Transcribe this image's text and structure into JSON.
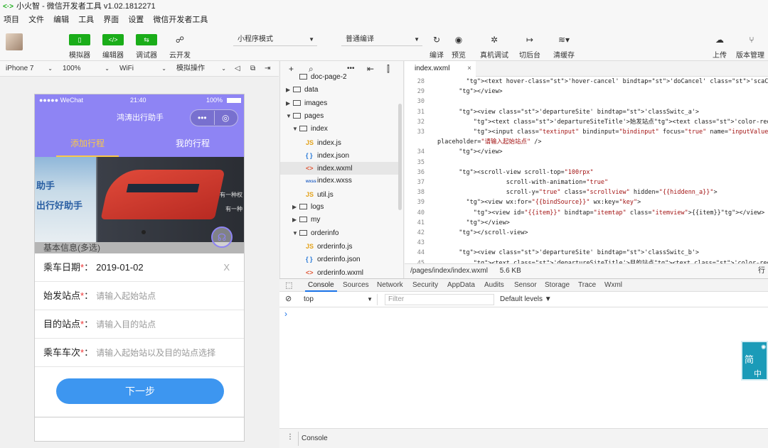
{
  "titlebar": {
    "logo": "<·>",
    "title": "小火智 - 微信开发者工具 v1.02.1812271"
  },
  "menu": [
    "项目",
    "文件",
    "编辑",
    "工具",
    "界面",
    "设置",
    "微信开发者工具"
  ],
  "toolbar": {
    "simulator": "模拟器",
    "editor": "编辑器",
    "debugger": "调试器",
    "cloud": "云开发",
    "mode": "小程序模式",
    "compile": "普通编译",
    "compile_btn": "编译",
    "preview": "预览",
    "real_debug": "真机调试",
    "background": "切后台",
    "clear_cache": "清缓存",
    "upload": "上传",
    "version": "版本管理"
  },
  "devbar": {
    "device": "iPhone 7",
    "zoom": "100%",
    "network": "WiFi",
    "operation": "模拟操作"
  },
  "phone": {
    "carrier": "●●●●● WeChat",
    "time": "21:40",
    "battery": "100%",
    "nav_title": "鸿涛出行助手",
    "capsule_more": "•••",
    "capsule_close": "◎",
    "tabs": [
      "添加行程",
      "我的行程"
    ],
    "banner_text_1": "助手",
    "banner_text_2": "出行好助手",
    "banner_right_1": "有一种权",
    "banner_right_2": "有一种",
    "section_title": "基本信息(多选)",
    "rows": [
      {
        "label": "乘车日期",
        "star": "*",
        "colon": "：",
        "value": "2019-01-02",
        "clear": "X"
      },
      {
        "label": "始发站点",
        "star": "*",
        "colon": "：",
        "placeholder": "请输入起始站点"
      },
      {
        "label": "目的站点",
        "star": "*",
        "colon": "：",
        "placeholder": "请输入目的站点"
      },
      {
        "label": "乘车车次",
        "star": "*",
        "colon": "：",
        "placeholder": "请输入起始站以及目的站点选择"
      }
    ],
    "next": "下一步"
  },
  "filetree": {
    "items": [
      {
        "name": "doc-page-2",
        "type": "folder",
        "arrow": "",
        "level": 1
      },
      {
        "name": "data",
        "type": "folder",
        "arrow": "▶",
        "level": 0
      },
      {
        "name": "images",
        "type": "folder",
        "arrow": "▶",
        "level": 0
      },
      {
        "name": "pages",
        "type": "folder-open",
        "arrow": "▼",
        "level": 0
      },
      {
        "name": "index",
        "type": "folder-open",
        "arrow": "▼",
        "level": 1
      },
      {
        "name": "index.js",
        "type": "js",
        "arrow": "",
        "level": 2
      },
      {
        "name": "index.json",
        "type": "json",
        "arrow": "",
        "level": 2
      },
      {
        "name": "index.wxml",
        "type": "wxml",
        "arrow": "",
        "level": 2,
        "selected": true
      },
      {
        "name": "index.wxss",
        "type": "wxss",
        "arrow": "",
        "level": 2
      },
      {
        "name": "util.js",
        "type": "js",
        "arrow": "",
        "level": 2
      },
      {
        "name": "logs",
        "type": "folder",
        "arrow": "▶",
        "level": 1
      },
      {
        "name": "my",
        "type": "folder",
        "arrow": "▶",
        "level": 1
      },
      {
        "name": "orderinfo",
        "type": "folder-open",
        "arrow": "▼",
        "level": 1
      },
      {
        "name": "orderinfo.js",
        "type": "js",
        "arrow": "",
        "level": 2
      },
      {
        "name": "orderinfo.json",
        "type": "json",
        "arrow": "",
        "level": 2
      },
      {
        "name": "orderinfo.wxml",
        "type": "wxml",
        "arrow": "",
        "level": 2
      }
    ],
    "icons": {
      "js": "JS",
      "json": "{ }",
      "wxml": "<>",
      "wxss": "wxss"
    }
  },
  "editor": {
    "tab": "index.wxml",
    "tab_close": "×",
    "lines": [
      {
        "n": "28",
        "code": "    <text hover-class='hover-cancel' bindtap='doCancel' class='scaCancel'>X</text>"
      },
      {
        "n": "29",
        "code": "  </view>"
      },
      {
        "n": "30",
        "code": ""
      },
      {
        "n": "31",
        "code": "  <view class='departureSite' bindtap='classSwitc_a'>"
      },
      {
        "n": "32",
        "code": "      <text class='departureSiteTitle'>始发站点<text class='color-red'>*</text>:</text>"
      },
      {
        "n": "33",
        "code": "      <input class=\"textinput\" bindinput=\"bindinput\" focus=\"true\" name=\"inputValue\" value="
      },
      {
        "n": "",
        "code": "placeholder=\"请输入起始站点\" />"
      },
      {
        "n": "34",
        "code": "  </view>"
      },
      {
        "n": "35",
        "code": ""
      },
      {
        "n": "36",
        "code": "  <scroll-view scroll-top=\"100rpx\""
      },
      {
        "n": "37",
        "code": "               scroll-with-animation=\"true\""
      },
      {
        "n": "38",
        "code": "               scroll-y=\"true\" class=\"scrollview\" hidden=\"{{hiddenn_a}}\">"
      },
      {
        "n": "39",
        "code": "    <view wx:for=\"{{bindSource}}\" wx:key=\"key\">"
      },
      {
        "n": "40",
        "code": "      <view id=\"{{item}}\" bindtap=\"itemtap\" class=\"itemview\">{{item}}</view>"
      },
      {
        "n": "41",
        "code": "    </view>"
      },
      {
        "n": "42",
        "code": "  </scroll-view>"
      },
      {
        "n": "43",
        "code": ""
      },
      {
        "n": "44",
        "code": "  <view class='departureSite' bindtap='classSwitc_b'>"
      },
      {
        "n": "45",
        "code": "      <text class='departureSiteTitle'>目的站点<text class='color-red'>*</text>:</text>"
      }
    ],
    "status_path": "/pages/index/index.wxml",
    "status_size": "5.6 KB",
    "status_right": "行"
  },
  "devtools": {
    "tabs": [
      "Console",
      "Sources",
      "Network",
      "Security",
      "AppData",
      "Audits",
      "Sensor",
      "Storage",
      "Trace",
      "Wxml"
    ],
    "context": "top",
    "filter_placeholder": "Filter",
    "levels": "Default levels ▼",
    "prompt": "›",
    "bottom_tab": "Console"
  },
  "ime": {
    "char1": "简",
    "char2": "中"
  }
}
